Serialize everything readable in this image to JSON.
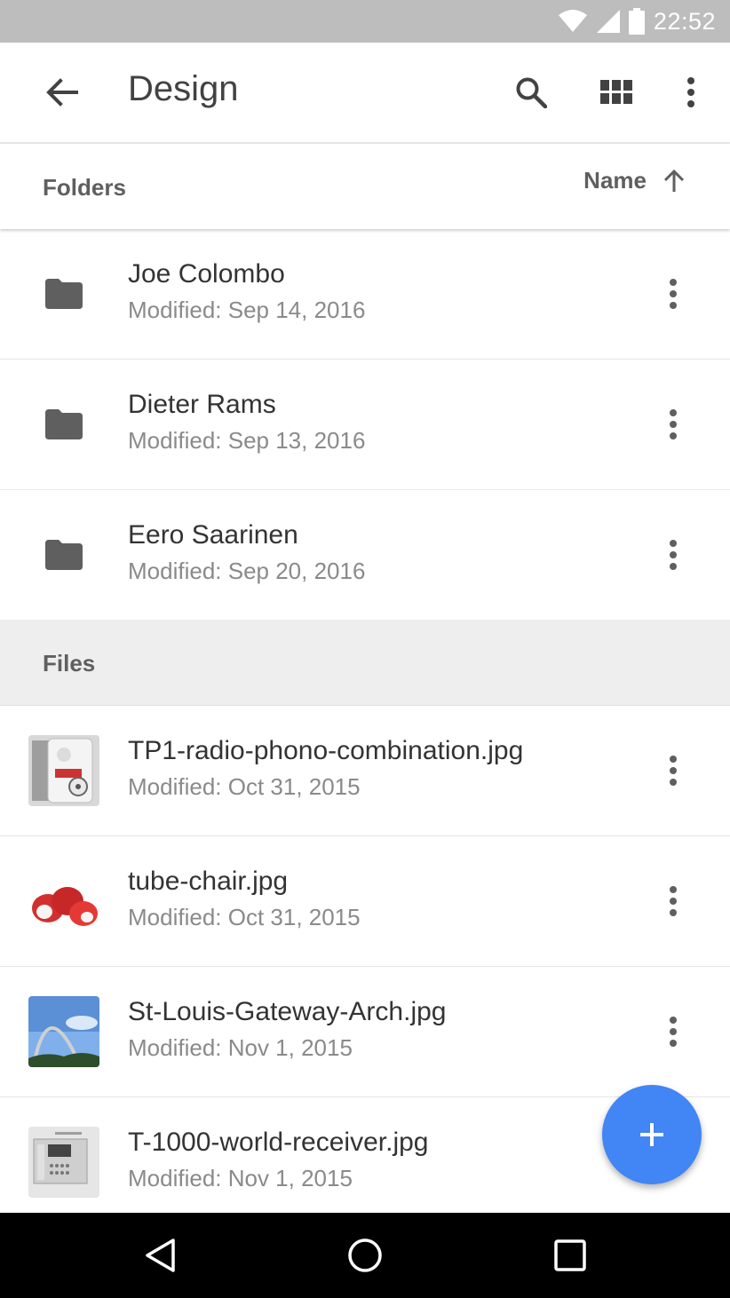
{
  "status_bar": {
    "time": "22:52"
  },
  "app_bar": {
    "title": "Design"
  },
  "folders_section": {
    "label": "Folders",
    "sort_label": "Name",
    "items": [
      {
        "name": "Joe Colombo",
        "modified": "Modified: Sep 14, 2016"
      },
      {
        "name": "Dieter Rams",
        "modified": "Modified: Sep 13, 2016"
      },
      {
        "name": "Eero Saarinen",
        "modified": "Modified: Sep 20, 2016"
      }
    ]
  },
  "files_section": {
    "label": "Files",
    "items": [
      {
        "name": "TP1-radio-phono-combination.jpg",
        "modified": "Modified: Oct 31, 2015"
      },
      {
        "name": "tube-chair.jpg",
        "modified": "Modified: Oct 31, 2015"
      },
      {
        "name": "St-Louis-Gateway-Arch.jpg",
        "modified": "Modified: Nov 1, 2015"
      },
      {
        "name": "T-1000-world-receiver.jpg",
        "modified": "Modified: Nov 1, 2015"
      }
    ]
  },
  "colors": {
    "fab": "#4285f4",
    "status_bar": "#bdbdbd",
    "section_bg": "#eeeeee"
  }
}
